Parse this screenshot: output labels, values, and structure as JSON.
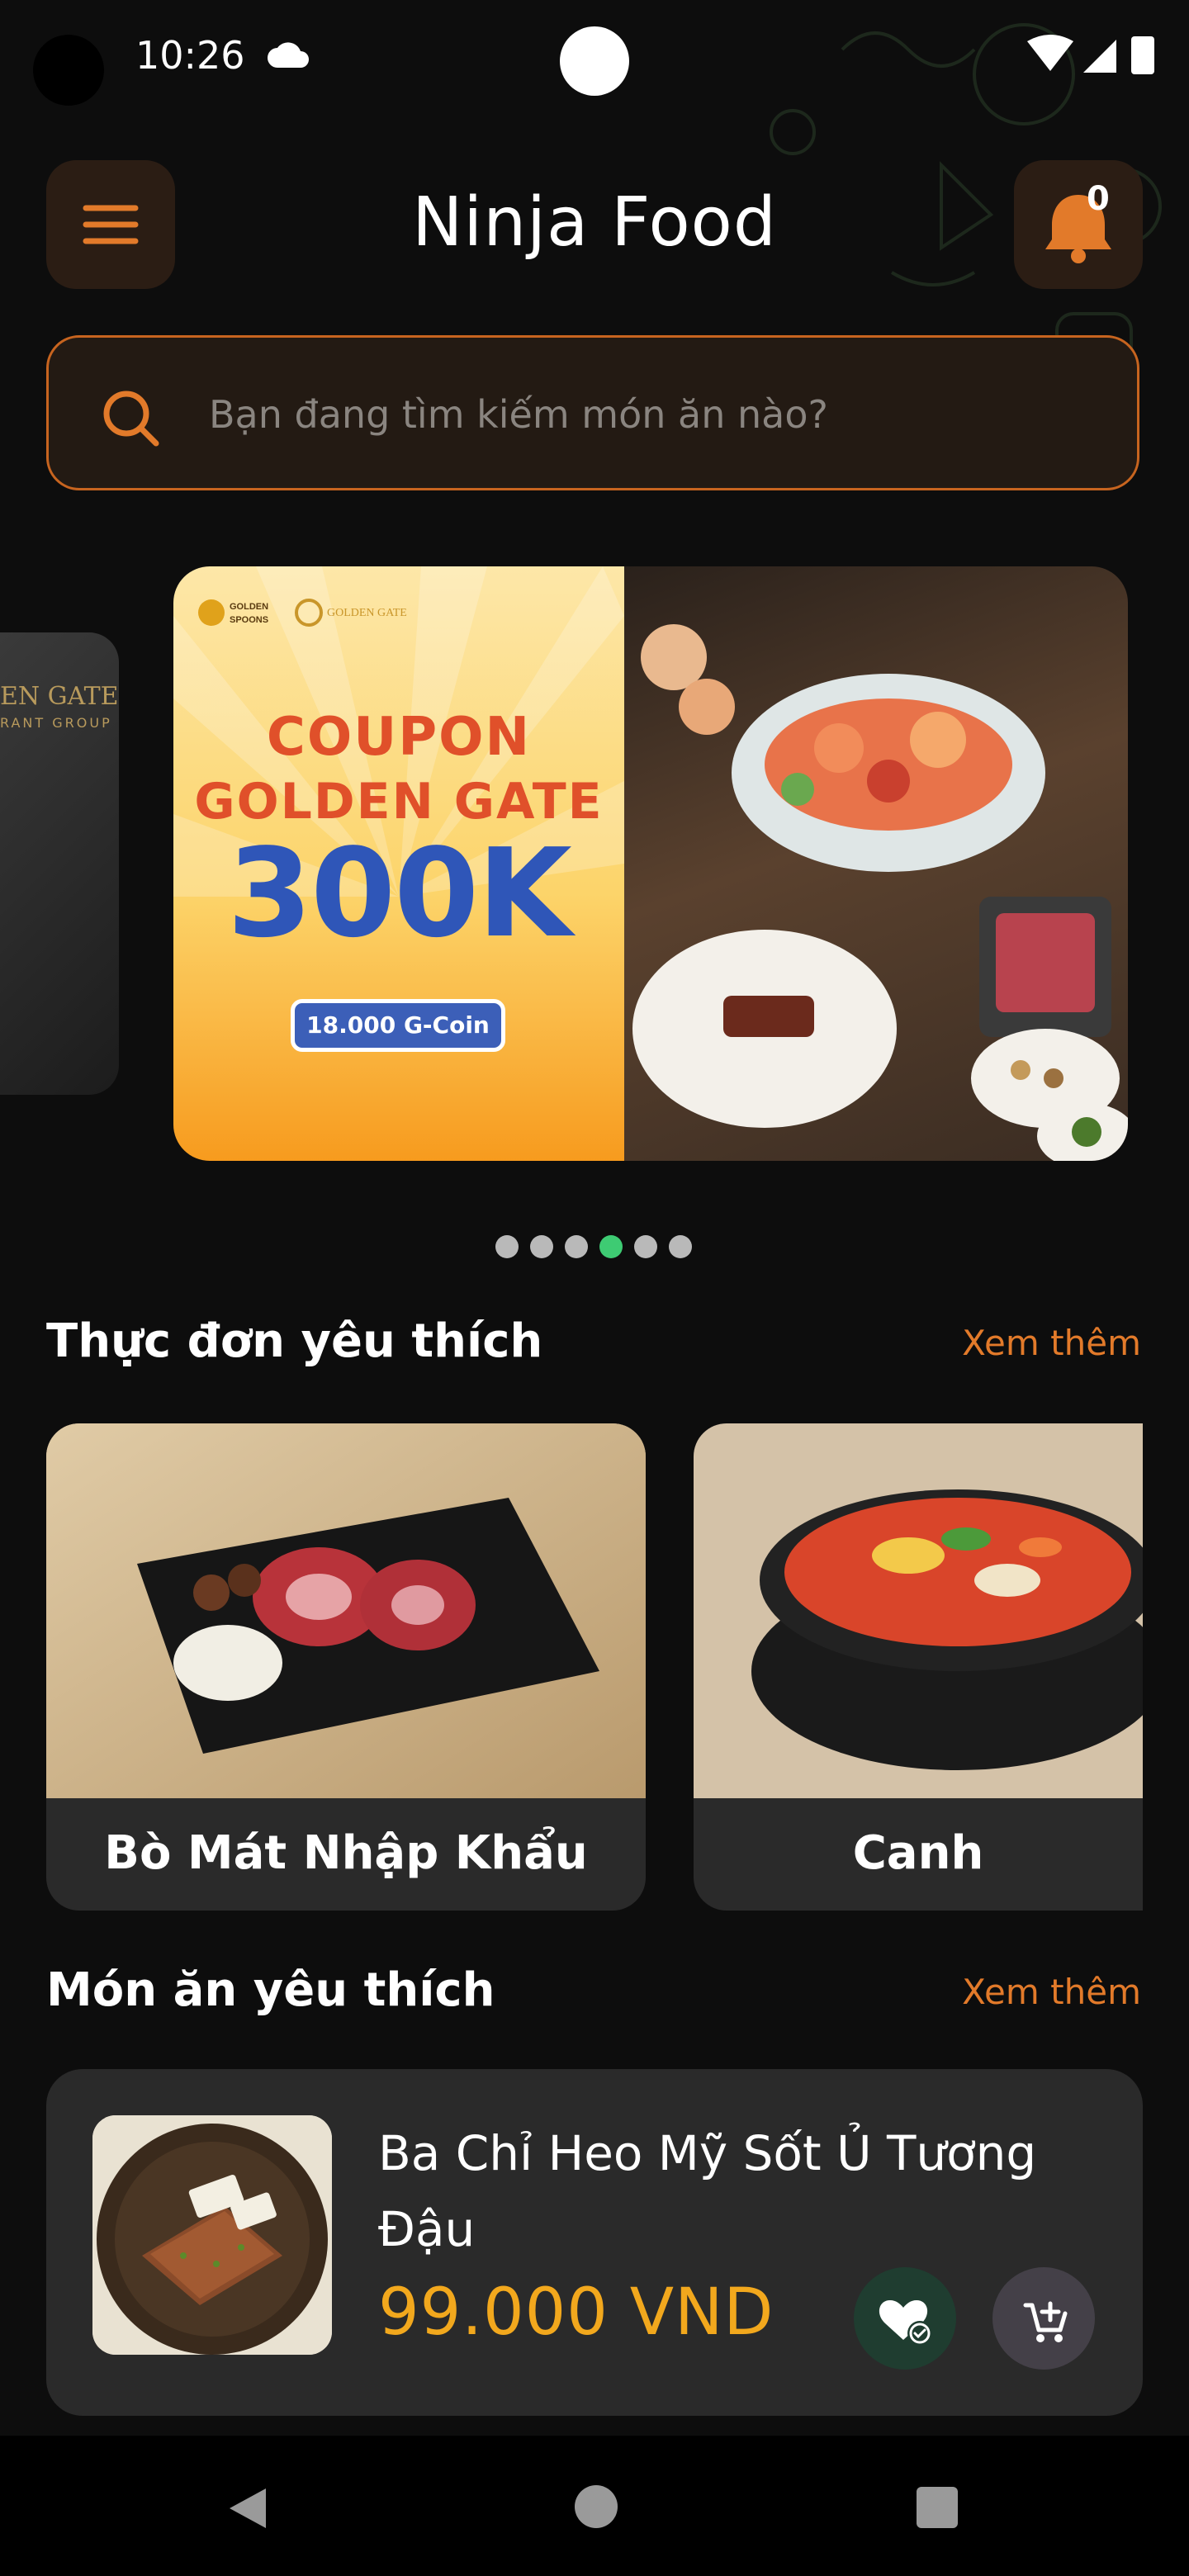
{
  "status_bar": {
    "time": "10:26"
  },
  "header": {
    "title": "Ninja Food",
    "notification_count": "0"
  },
  "search": {
    "placeholder": "Bạn đang tìm kiếm món ăn nào?"
  },
  "banner": {
    "brand_1": "GOLDEN SPOONS",
    "brand_2": "GOLDEN GATE",
    "line_1": "COUPON",
    "line_2": "GOLDEN GATE",
    "amount": "300K",
    "coin_price": "18.000 G-Coin",
    "prev_banner_brand": "EN GATE",
    "prev_banner_sub": "RANT GROUP"
  },
  "carousel": {
    "count": 6,
    "active_index": 3
  },
  "favorite_menu": {
    "title": "Thực đơn yêu thích",
    "more_label": "Xem thêm",
    "items": [
      {
        "label": "Bò Mát Nhập Khẩu"
      },
      {
        "label": "Canh"
      }
    ]
  },
  "favorite_dishes": {
    "title": "Món ăn yêu thích",
    "more_label": "Xem thêm",
    "items": [
      {
        "name": "Ba Chỉ Heo Mỹ Sốt Ủ Tương Đậu",
        "price": "99.000 VND"
      }
    ]
  },
  "colors": {
    "accent": "#e27a2a",
    "price": "#f2a81d",
    "active_dot": "#3ecb73",
    "background": "#0d0d0d",
    "card": "#2a2a2a"
  },
  "icons": [
    "menu-icon",
    "bell-icon",
    "search-icon",
    "favorite-check-icon",
    "add-to-cart-icon",
    "back-icon",
    "home-icon",
    "recents-icon",
    "wifi-icon",
    "signal-icon",
    "battery-icon",
    "cloud-icon"
  ]
}
